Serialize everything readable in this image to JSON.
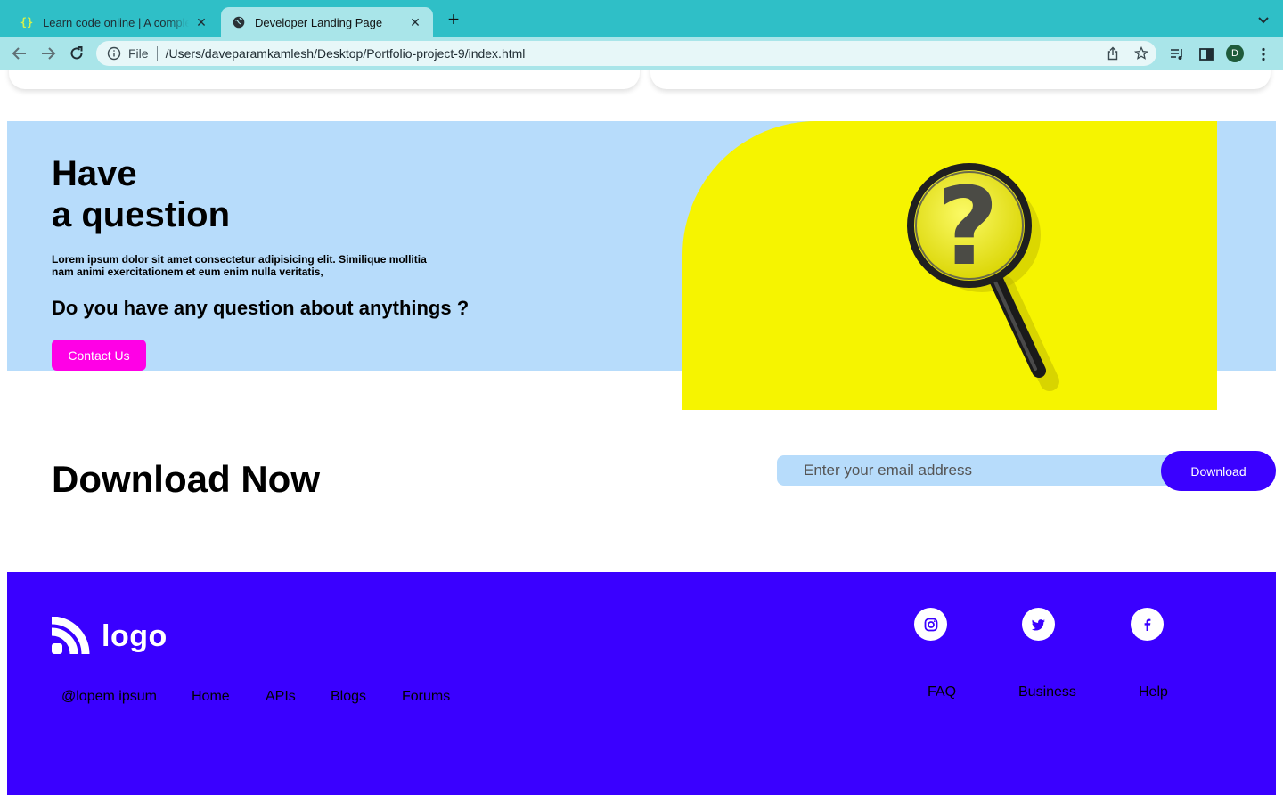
{
  "browser": {
    "tabs": [
      {
        "title": "Learn code online | A complete",
        "active": false,
        "favicon": "braces-icon"
      },
      {
        "title": "Developer Landing Page",
        "active": true,
        "favicon": "globe-icon"
      }
    ],
    "address": {
      "scheme_label": "File",
      "url": "/Users/daveparamkamlesh/Desktop/Portfolio-project-9/index.html"
    },
    "profile_initial": "D"
  },
  "question_section": {
    "title_line1": "Have",
    "title_line2": "a question",
    "lorem": "Lorem ipsum dolor sit amet consectetur adipisicing elit. Similique mollitia nam animi exercitationem et eum enim nulla veritatis,",
    "ask": "Do you have any question about anythings ?",
    "contact_label": "Contact Us"
  },
  "download_section": {
    "title_bold": "Download",
    "title_rest": "Now",
    "email_placeholder": "Enter your email address",
    "button_label": "Download"
  },
  "footer": {
    "logo_text": "logo",
    "nav": [
      "@lopem ipsum",
      "Home",
      "APIs",
      "Blogs",
      "Forums"
    ],
    "social": [
      "instagram-icon",
      "twitter-icon",
      "facebook-icon"
    ],
    "links": [
      "FAQ",
      "Business",
      "Help"
    ]
  },
  "colors": {
    "tabbar": "#2fbfc7",
    "toolbar": "#a9e5e9",
    "light_blue": "#b7dcfb",
    "magenta": "#ff00e6",
    "yellow": "#f6f400",
    "brand_blue": "#3a00ff"
  }
}
